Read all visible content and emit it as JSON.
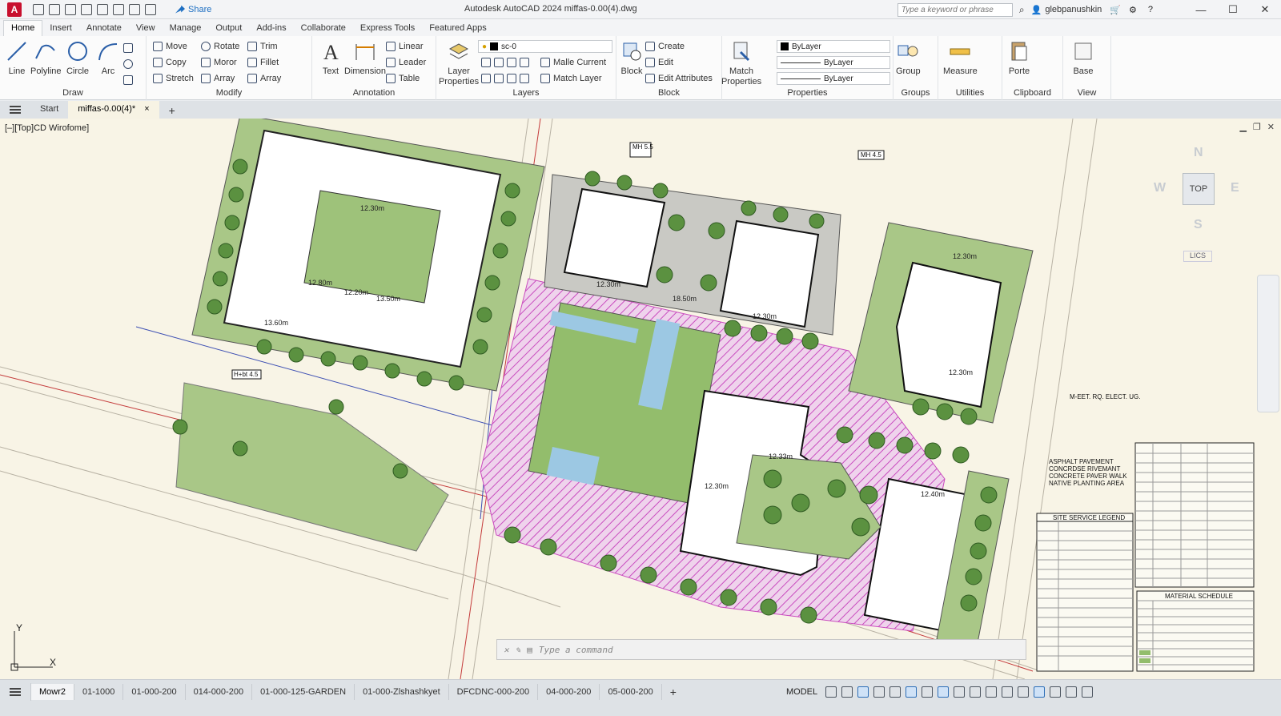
{
  "titlebar": {
    "app_logo": "A",
    "share_label": "Share",
    "title": "Autodesk AutoCAD 2024   miffas-0.00(4).dwg",
    "search_placeholder": "Type a keyword or phrase",
    "user": "glebpanushkin",
    "minimize": "—",
    "maximize": "☐",
    "close": "✕"
  },
  "ribbon_tabs": [
    "Home",
    "Insert",
    "Annotate",
    "View",
    "Manage",
    "Output",
    "Add-ins",
    "Collaborate",
    "Express Tools",
    "Featured Apps"
  ],
  "ribbon": {
    "draw": {
      "label": "Draw",
      "line": "Line",
      "polyline": "Polyline",
      "circle": "Circle",
      "arc": "Arc"
    },
    "modify": {
      "label": "Modify",
      "move": "Move",
      "rotate": "Rotate",
      "trim": "Trim",
      "copy": "Copy",
      "mirror": "Moror",
      "fillet": "Fillet",
      "stretch": "Stretch",
      "scale": "Array",
      "array": "Array"
    },
    "annotation": {
      "label": "Annotation",
      "text": "Text",
      "dimension": "Dimension",
      "linear": "Linear",
      "leader": "Leader",
      "table": "Table"
    },
    "layers": {
      "label": "Layers",
      "layer_properties": "Layer Properties",
      "current_layer": "sc-0",
      "make_current": "Malle Current",
      "match_layer": "Match Layer"
    },
    "block": {
      "label": "Block",
      "insert": "Block",
      "create": "Create",
      "edit": "Edit",
      "edit_attributes": "Edit Attributes"
    },
    "properties": {
      "label": "Properties",
      "match": "Match Properties",
      "color": "ByLayer",
      "linetype": "ByLayer",
      "lineweight": "ByLayer"
    },
    "groups": {
      "label": "Groups",
      "group": "Group"
    },
    "utilities": {
      "label": "Utilities",
      "measure": "Measure"
    },
    "clipboard": {
      "label": "Clipboard",
      "paste": "Porte"
    },
    "view": {
      "label": "View",
      "base": "Base"
    }
  },
  "file_tabs": {
    "start": "Start",
    "active": "miffas-0.00(4)*",
    "close": "×",
    "add": "+"
  },
  "canvas": {
    "viewport_label": "[–][Top]CD Wirofome]",
    "viewcube_top": "TOP",
    "compass_n": "N",
    "compass_s": "S",
    "compass_e": "E",
    "compass_w": "W",
    "wcs": "LICS",
    "command_placeholder": "Type  a  command",
    "ucs_y": "Y",
    "ucs_x": "X",
    "drawing_labels": {
      "mh1": "MH 5.5",
      "mh2": "MH 4.5",
      "hbt": "H+bt 4.5",
      "legend_notes": [
        "ASPHALT PAVEMENT",
        "CONCRDSE RIVEMANT",
        "CONCRETE PAVER WALK",
        "NATIVE PLANTING AREA"
      ],
      "elect": "M-EET. RQ. ELECT. UG.",
      "site_legend_title": "SITE SERVICE LEGEND",
      "material_schedule_title": "MATERIAL SCHEDULE",
      "dims": [
        "12.30m",
        "12.20m",
        "13.50m",
        "12.80m",
        "13.60m",
        "12.30m",
        "12.30m",
        "12.30m",
        "12.33m",
        "12.40m",
        "12.30m",
        "12.30m",
        "18.50m"
      ]
    }
  },
  "statusbar": {
    "layout_tabs": [
      "Mowr2",
      "01-1000",
      "01-000-200",
      "014-000-200",
      "01-000-125-GARDEN",
      "01-000-Zlshashkyet",
      "DFCDNC-000-200",
      "04-000-200",
      "05-000-200"
    ],
    "add_tab": "+",
    "model": "MODEL"
  },
  "colors": {
    "canvas_bg": "#f8f4e6",
    "lawn": "#8fb56b",
    "hatch": "#c94cbf",
    "water": "#9cc8e3",
    "trees": "#5b9140",
    "building": "#ffffff",
    "pavement": "#c9c9c4",
    "accent_blue": "#1e6fc2",
    "logo_red": "#c8102e"
  }
}
